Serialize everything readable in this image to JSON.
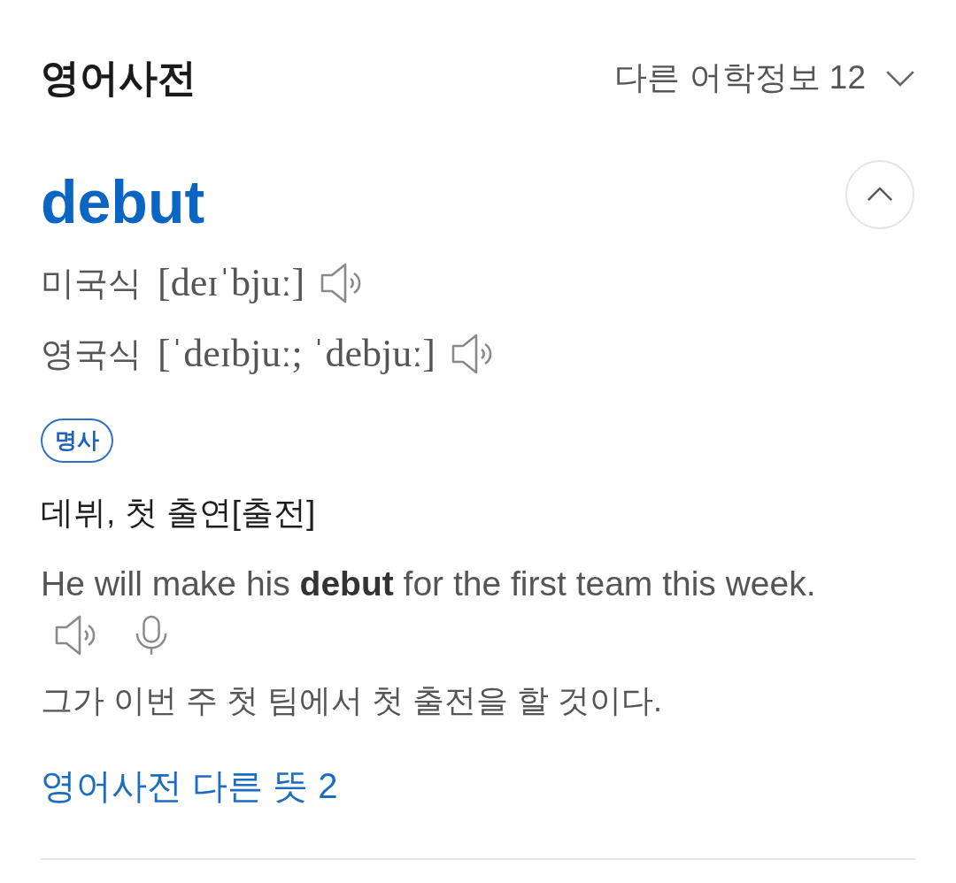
{
  "header": {
    "title": "영어사전",
    "other_info": {
      "label": "다른 어학정보 12",
      "expanded": false
    }
  },
  "entry": {
    "headword": "debut",
    "collapse_button": {
      "expanded": true
    },
    "pronunciations": [
      {
        "region": "미국식",
        "ipa": "[deɪˈbjuː]"
      },
      {
        "region": "영국식",
        "ipa": "[ˈdeɪbjuː; ˈdebjuː]"
      }
    ],
    "part_of_speech": "명사",
    "meanings": [
      {
        "definition": "데뷔, 첫 출연[출전]",
        "example": "He will make his **debut** for the first team this week.",
        "translation": "그가 이번 주 첫 팀에서 첫 출전을 할 것이다."
      }
    ],
    "more_link": "영어사전 다른 뜻 2"
  }
}
